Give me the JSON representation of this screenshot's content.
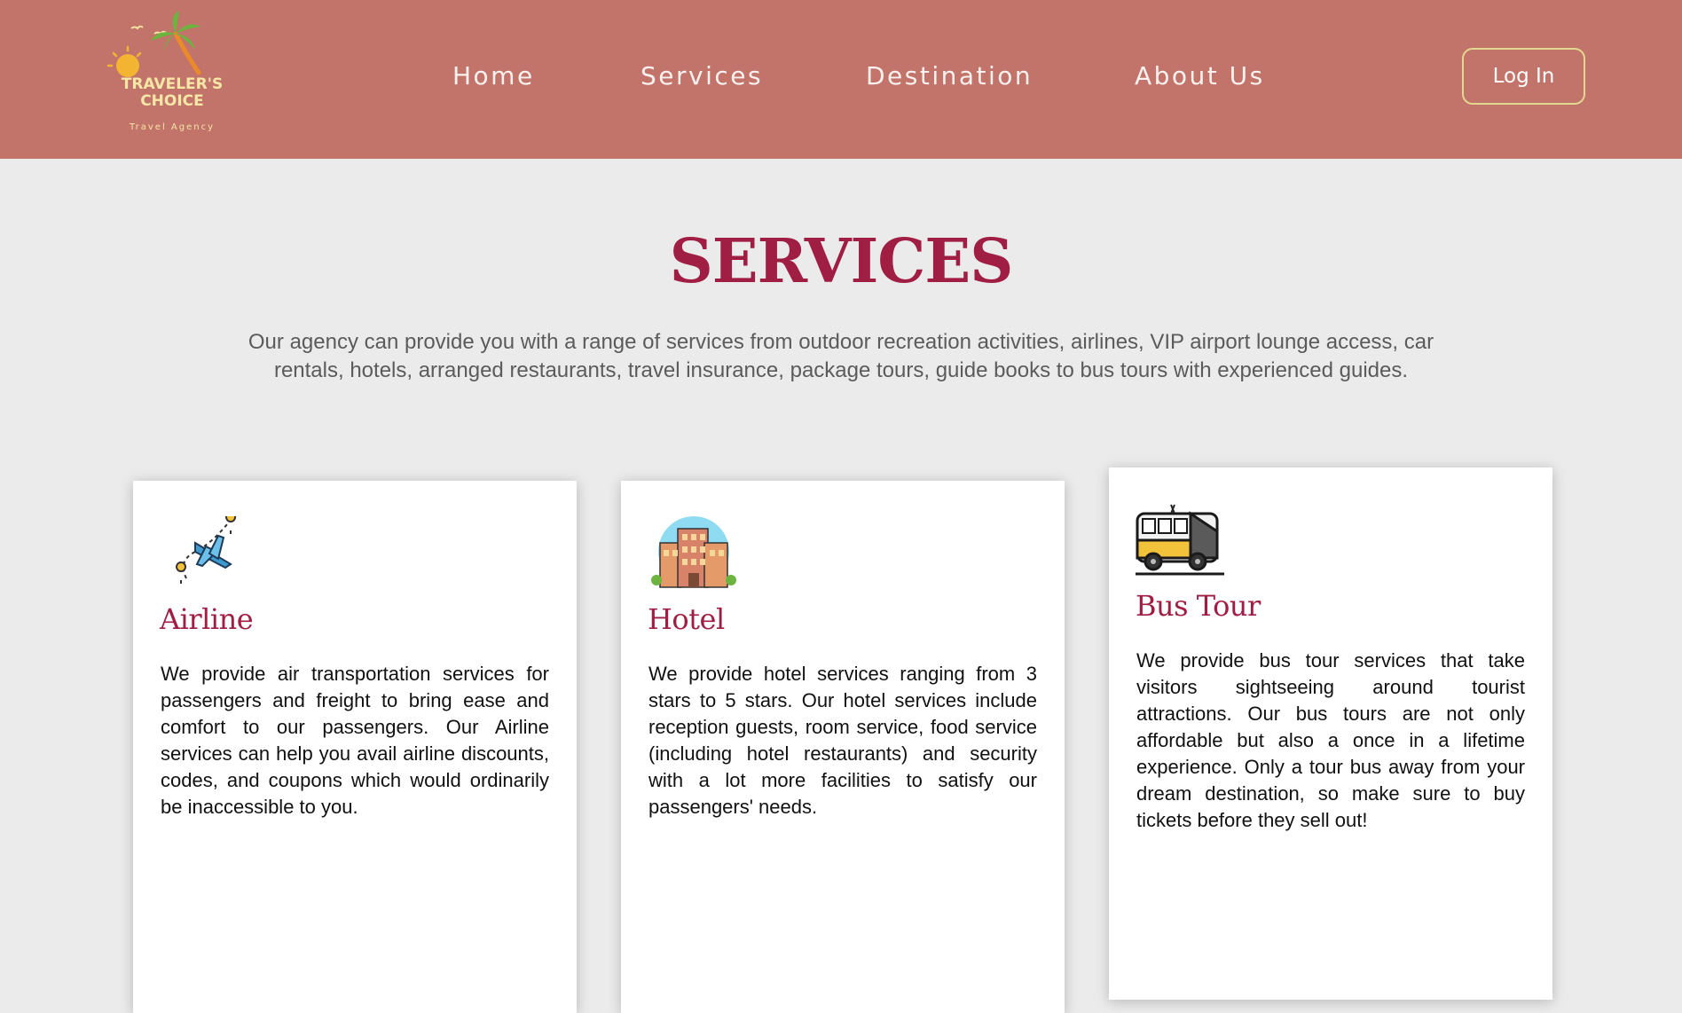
{
  "brand": {
    "logo_line1": "TRAVELER'S",
    "logo_line2": "CHOICE",
    "logo_tagline": "Travel Agency"
  },
  "nav": {
    "items": [
      "Home",
      "Services",
      "Destination",
      "About Us"
    ],
    "login_label": "Log In"
  },
  "services": {
    "title": "SERVICES",
    "intro": "Our agency can provide you with a range of services from outdoor recreation activities, airlines, VIP airport lounge access, car rentals, hotels, arranged restaurants, travel insurance, package tours, guide books to bus tours with experienced guides.",
    "cards": [
      {
        "icon": "airplane-icon",
        "title": "Airline",
        "text": "We provide air transportation services for passengers and freight to bring ease and comfort to our passengers. Our Airline services can help you avail airline discounts, codes, and coupons which would ordinarily be inaccessible to you."
      },
      {
        "icon": "hotel-icon",
        "title": "Hotel",
        "text": "We provide hotel services ranging from 3 stars to 5 stars. Our hotel services include reception guests, room service, food service (including hotel restaurants) and security with a lot more facilities to satisfy our passengers' needs."
      },
      {
        "icon": "bus-icon",
        "title": "Bus Tour",
        "text": "We provide bus tour services that take visitors sightseeing around tourist attractions. Our bus tours are not only affordable but also a once in a lifetime experience. Only a tour bus away from your dream destination, so make sure to buy tickets before they sell out!"
      }
    ]
  },
  "colors": {
    "header_bg": "#c2736a",
    "accent": "#a01e44",
    "page_bg": "#ebebeb",
    "login_border": "#e3d890"
  }
}
